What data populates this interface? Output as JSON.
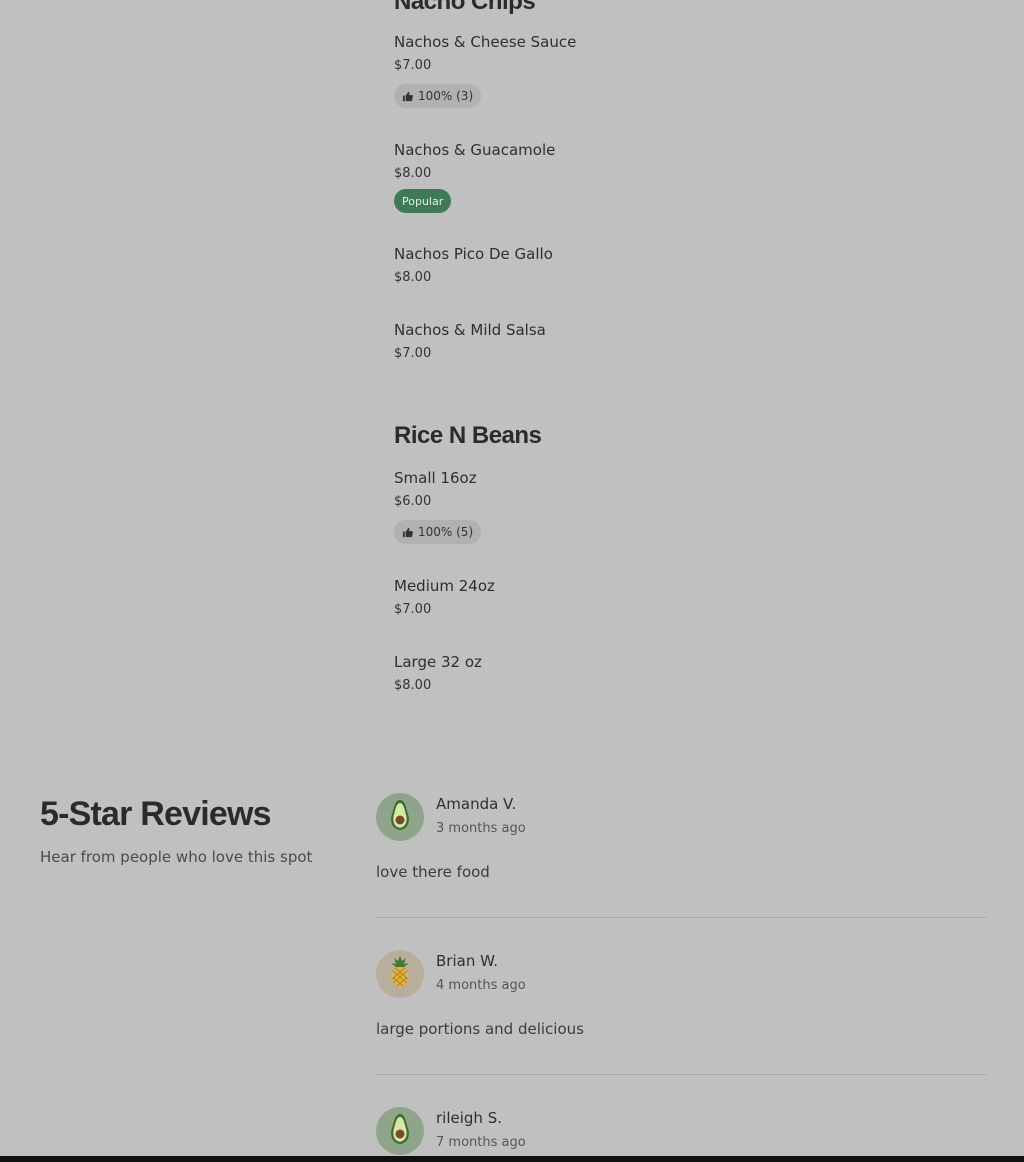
{
  "menu": {
    "categories": [
      {
        "title": "Nacho Chips",
        "items": [
          {
            "name": "Nachos & Cheese Sauce",
            "price": "$7.00",
            "rating": "100% (3)"
          },
          {
            "name": "Nachos & Guacamole",
            "price": "$8.00",
            "badge": "Popular"
          },
          {
            "name": "Nachos Pico De Gallo",
            "price": "$8.00"
          },
          {
            "name": "Nachos & Mild Salsa",
            "price": "$7.00"
          }
        ]
      },
      {
        "title": "Rice N Beans",
        "items": [
          {
            "name": "Small 16oz",
            "price": "$6.00",
            "rating": "100% (5)"
          },
          {
            "name": "Medium 24oz",
            "price": "$7.00"
          },
          {
            "name": "Large 32 oz",
            "price": "$8.00"
          }
        ]
      }
    ]
  },
  "reviews": {
    "title": "5-Star Reviews",
    "subtitle": "Hear from people who love this spot",
    "items": [
      {
        "name": "Amanda V.",
        "time": "3 months ago",
        "text": "love there food",
        "avatar": "avocado-icon"
      },
      {
        "name": "Brian W.",
        "time": "4 months ago",
        "text": "large portions and delicious",
        "avatar": "pineapple-icon"
      },
      {
        "name": "rileigh S.",
        "time": "7 months ago",
        "text": "",
        "avatar": "avocado-icon"
      }
    ]
  },
  "colors": {
    "background": "#c0c0c0",
    "popular_badge": "#3f7a57",
    "rating_pill": "#b1b1b1"
  }
}
